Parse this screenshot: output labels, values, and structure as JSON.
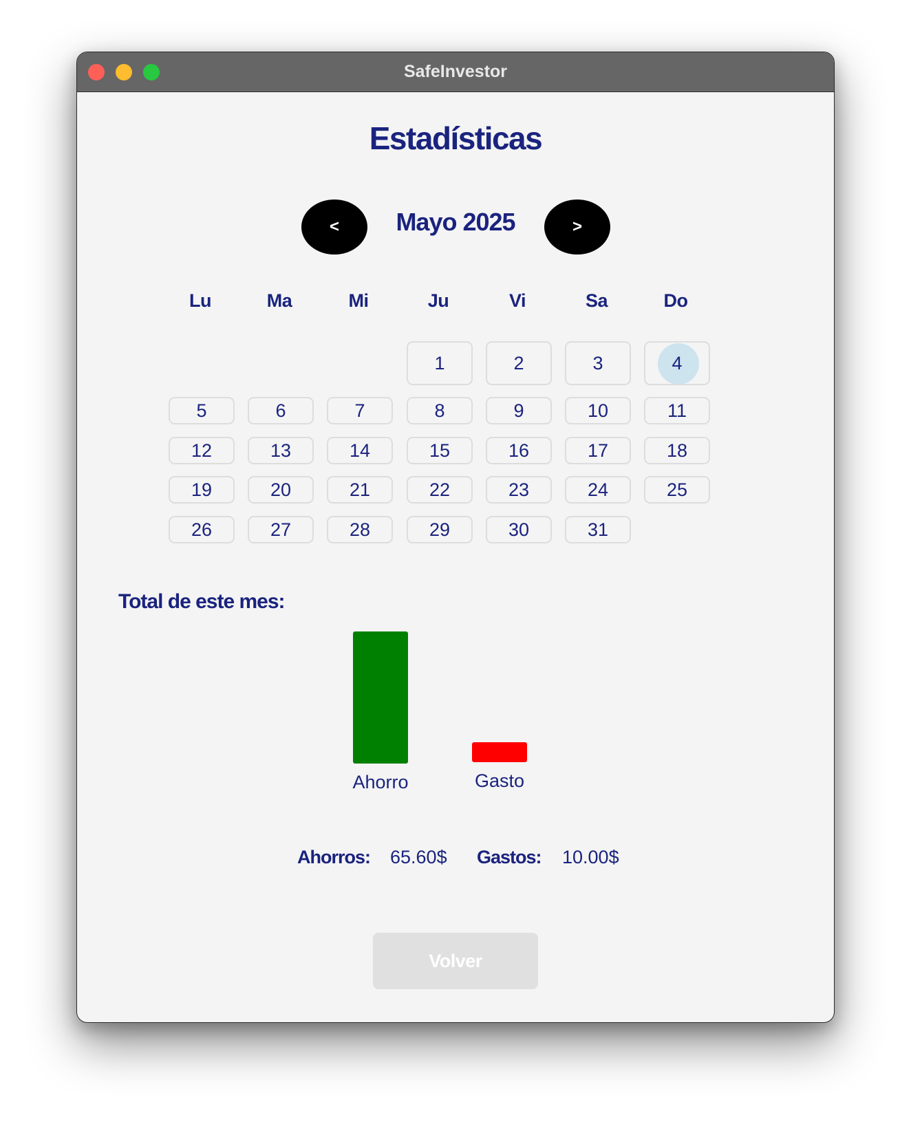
{
  "window": {
    "title": "SafeInvestor"
  },
  "page": {
    "title": "Estadísticas"
  },
  "calendar": {
    "prev_label": "<",
    "next_label": ">",
    "month_label": "Mayo 2025",
    "weekdays": [
      "Lu",
      "Ma",
      "Mi",
      "Ju",
      "Vi",
      "Sa",
      "Do"
    ],
    "days": [
      "1",
      "2",
      "3",
      "4",
      "5",
      "6",
      "7",
      "8",
      "9",
      "10",
      "11",
      "12",
      "13",
      "14",
      "15",
      "16",
      "17",
      "18",
      "19",
      "20",
      "21",
      "22",
      "23",
      "24",
      "25",
      "26",
      "27",
      "28",
      "29",
      "30",
      "31"
    ],
    "selected_day": "4"
  },
  "summary": {
    "section_title": "Total de este mes:",
    "ahorros_label": "Ahorros:",
    "ahorros_value": "65.60$",
    "gastos_label": "Gastos:",
    "gastos_value": "10.00$"
  },
  "chart_data": {
    "type": "bar",
    "categories": [
      "Ahorro",
      "Gasto"
    ],
    "values": [
      65.6,
      10.0
    ],
    "colors": [
      "#008000",
      "#ff0000"
    ],
    "title": "",
    "xlabel": "",
    "ylabel": ""
  },
  "actions": {
    "back_label": "Volver"
  }
}
